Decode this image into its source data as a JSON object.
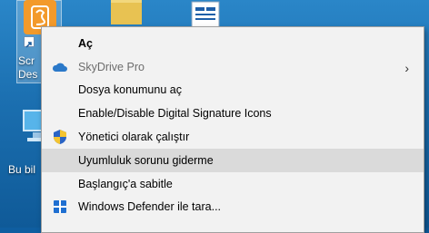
{
  "desktop": {
    "icons": [
      {
        "label_line1": "Scr",
        "label_line2": "Des"
      },
      {
        "label_line1": "Bu bil"
      }
    ]
  },
  "context_menu": {
    "items": [
      {
        "label": "Aç",
        "icon": "none",
        "bold": true,
        "disabled": false,
        "submenu": false
      },
      {
        "label": "SkyDrive Pro",
        "icon": "cloud-icon",
        "bold": false,
        "disabled": true,
        "submenu": true,
        "submenu_glyph": "›"
      },
      {
        "label": "Dosya konumunu aç",
        "icon": "none",
        "bold": false,
        "disabled": false,
        "submenu": false
      },
      {
        "label": "Enable/Disable Digital Signature Icons",
        "icon": "none",
        "bold": false,
        "disabled": false,
        "submenu": false
      },
      {
        "label": "Yönetici olarak çalıştır",
        "icon": "shield-icon",
        "bold": false,
        "disabled": false,
        "submenu": false
      },
      {
        "label": "Uyumluluk sorunu giderme",
        "icon": "none",
        "bold": false,
        "disabled": false,
        "submenu": false,
        "highlighted": true
      },
      {
        "label": "Başlangıç'a sabitle",
        "icon": "none",
        "bold": false,
        "disabled": false,
        "submenu": false
      },
      {
        "label": "Windows Defender ile tara...",
        "icon": "defender-icon",
        "bold": false,
        "disabled": false,
        "submenu": false
      }
    ]
  },
  "colors": {
    "desktop_bg": "#1b6fb0",
    "menu_bg": "#f2f2f2",
    "menu_hover": "#dadada",
    "disabled_text": "#6d6d6d",
    "app_icon_orange": "#f39a2b"
  }
}
